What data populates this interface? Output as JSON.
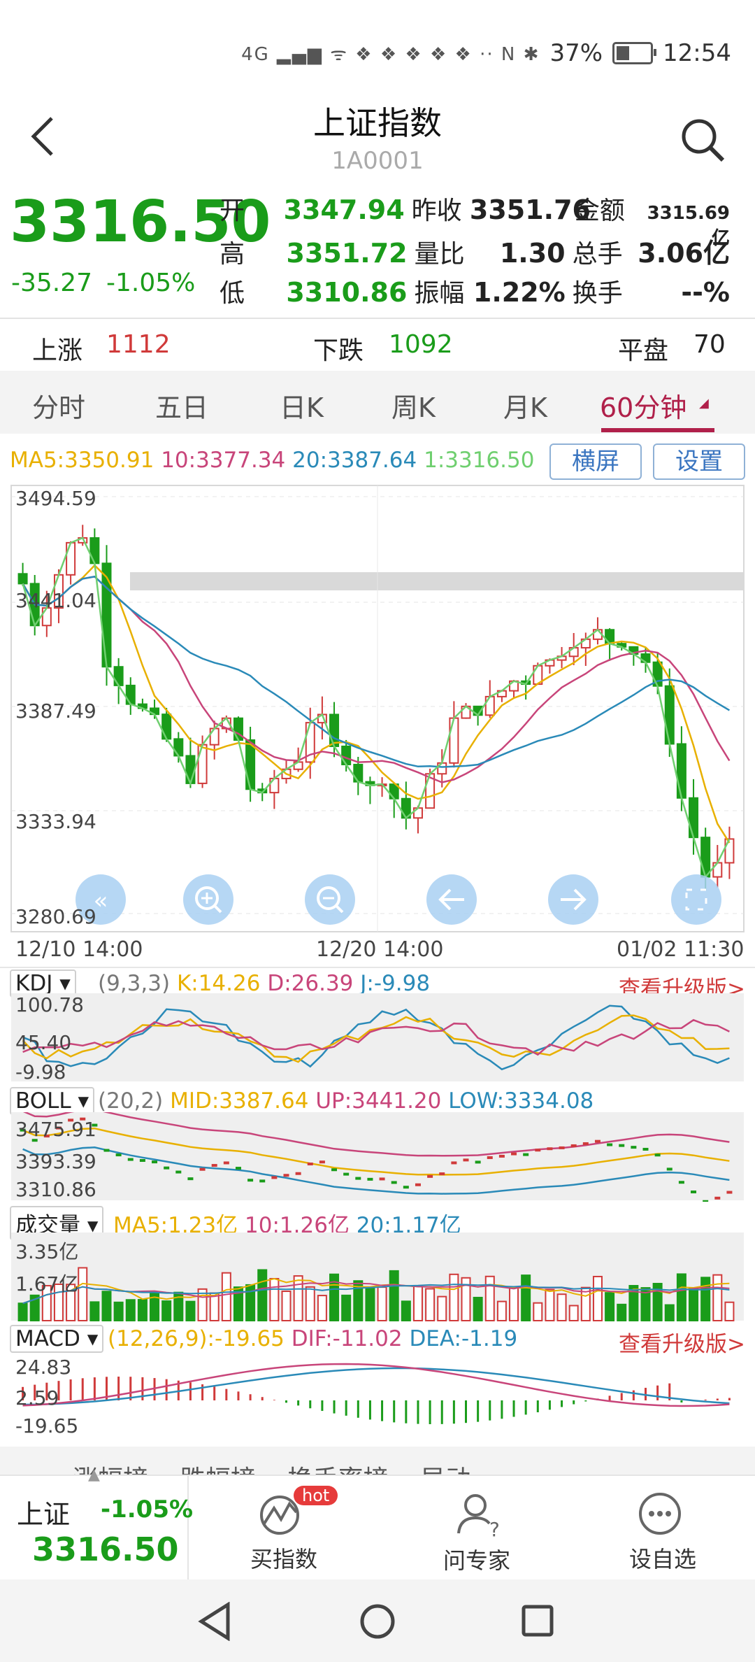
{
  "status_bar": {
    "signal_icons": "4G ▂▄▆ ᯤ ❖ ❖ ❖ ❖ ❖ ·· N ✱",
    "battery": "37%",
    "time": "12:54"
  },
  "header": {
    "title": "上证指数",
    "code": "1A0001"
  },
  "quote": {
    "price": "3316.50",
    "change": "-35.27",
    "change_pct": "-1.05%",
    "rows": [
      {
        "l1": "开",
        "v1": "3347.94",
        "l2": "昨收",
        "v2": "3351.76",
        "l3": "金额",
        "v3": "3315.69亿"
      },
      {
        "l1": "高",
        "v1": "3351.72",
        "l2": "量比",
        "v2": "1.30",
        "l3": "总手",
        "v3": "3.06亿"
      },
      {
        "l1": "低",
        "v1": "3310.86",
        "l2": "振幅",
        "v2": "1.22%",
        "l3": "换手",
        "v3": "--%"
      }
    ]
  },
  "breadth": {
    "up_label": "上涨",
    "up_value": "1112",
    "down_label": "下跌",
    "down_value": "1092",
    "flat_label": "平盘",
    "flat_value": "70"
  },
  "tabs": [
    "分时",
    "五日",
    "日K",
    "周K",
    "月K",
    "60分钟"
  ],
  "active_tab": "60分钟",
  "main_chart": {
    "legend": {
      "ma5": "MA5:3350.91",
      "ma10": "10:3377.34",
      "ma20": "20:3387.64",
      "ma1": "1:3316.50"
    },
    "btn_landscape": "横屏",
    "btn_settings": "设置",
    "y_ticks": [
      "3494.59",
      "3441.04",
      "3387.49",
      "3333.94",
      "3280.69"
    ],
    "x_ticks": [
      "12/10 14:00",
      "12/20 14:00",
      "01/02 11:30"
    ]
  },
  "kdj": {
    "name": "KDJ",
    "params": "(9,3,3)",
    "k": "K:14.26",
    "d": "D:26.39",
    "j": "J:-9.98",
    "upgrade": "查看升级版>",
    "y_ticks": [
      "100.78",
      "45.40",
      "-9.98"
    ]
  },
  "boll": {
    "name": "BOLL",
    "params": "(20,2)",
    "mid": "MID:3387.64",
    "up": "UP:3441.20",
    "low": "LOW:3334.08",
    "y_ticks": [
      "3475.91",
      "3393.39",
      "3310.86"
    ]
  },
  "volume": {
    "name": "成交量",
    "ma5": "MA5:1.23亿",
    "ma10": "10:1.26亿",
    "ma20": "20:1.17亿",
    "y_ticks": [
      "3.35亿",
      "1.67亿"
    ]
  },
  "macd": {
    "name": "MACD",
    "params": "(12,26,9):-19.65",
    "dif": "DIF:-11.02",
    "dea": "DEA:-1.19",
    "upgrade": "查看升级版>",
    "y_ticks": [
      "24.83",
      "2.59",
      "-19.65"
    ]
  },
  "hidden_tabs_text": "涨幅榜    跌幅榜    换手率榜    异动",
  "bottom": {
    "name": "上证",
    "pct": "-1.05%",
    "price": "3316.50",
    "buy_label": "买指数",
    "hot": "hot",
    "ask_label": "问专家",
    "fav_label": "设自选"
  },
  "colors": {
    "green": "#1a9c1a",
    "red": "#d03a3a",
    "ma5": "#e8b000",
    "ma10": "#c8457a",
    "ma20": "#2a8ab8",
    "ma1": "#6fcf6f",
    "accent": "#b0204a"
  }
}
